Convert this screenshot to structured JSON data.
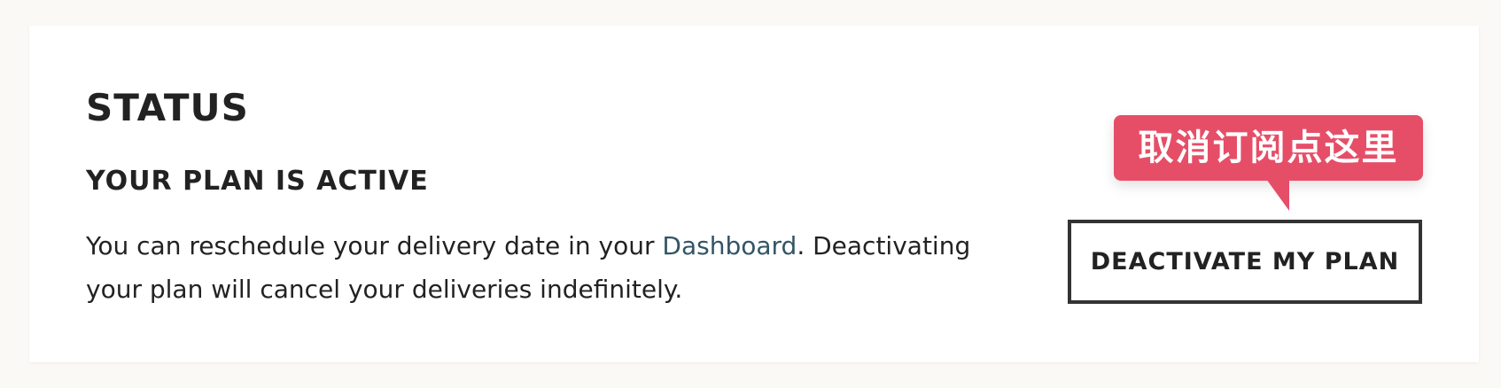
{
  "status": {
    "title": "STATUS",
    "subtitle": "YOUR PLAN IS ACTIVE",
    "description_before": "You can reschedule your delivery date in your ",
    "dashboard_link": "Dashboard",
    "description_after": ". Deactivating your plan will cancel your deliveries indefinitely."
  },
  "tooltip": {
    "text": "取消订阅点这里"
  },
  "actions": {
    "deactivate_label": "DEACTIVATE MY PLAN"
  },
  "colors": {
    "background": "#faf9f6",
    "card": "#ffffff",
    "text": "#222222",
    "link": "#335566",
    "tooltip": "#e64e68",
    "button_border": "#333333"
  }
}
